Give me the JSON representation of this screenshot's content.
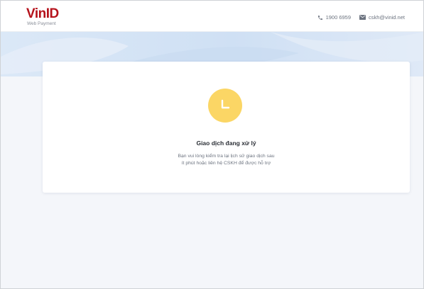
{
  "header": {
    "logo_text": "VinID",
    "logo_subtitle": "Web Payment",
    "phone": "1900 6959",
    "email": "cskh@vinid.net",
    "phone_icon": "phone-icon",
    "email_icon": "envelope-icon"
  },
  "status": {
    "icon": "clock-icon",
    "icon_color": "#fbd665",
    "title": "Giao dịch đang xử lý",
    "description_line1": "Bạn vui lòng kiểm tra lại lịch sử giao dịch sau",
    "description_line2": "ít phút hoặc liên hệ CSKH để được hỗ trợ"
  },
  "colors": {
    "brand": "#b5121b",
    "background": "#f4f6fa",
    "banner": "#d6e5f6"
  }
}
